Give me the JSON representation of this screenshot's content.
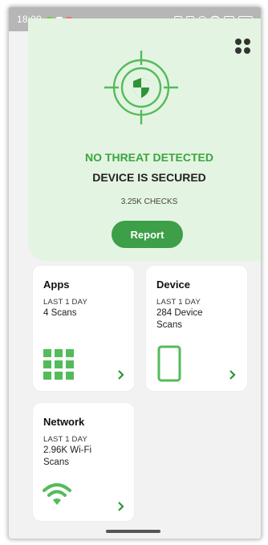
{
  "status_bar": {
    "time": "18:00"
  },
  "header": {
    "menu_icon": "grid-dots-icon"
  },
  "hero": {
    "status_line": "NO THREAT DETECTED",
    "secure_line": "DEVICE IS SECURED",
    "checks": "3.25K CHECKS",
    "report_label": "Report",
    "icon": "shield-radar-icon"
  },
  "cards": {
    "apps": {
      "title": "Apps",
      "period": "LAST 1 DAY",
      "value": "4 Scans",
      "icon": "apps-grid-icon"
    },
    "device": {
      "title": "Device",
      "period": "LAST 1 DAY",
      "value": "284 Device Scans",
      "icon": "phone-icon"
    },
    "network": {
      "title": "Network",
      "period": "LAST 1 DAY",
      "value": "2.96K Wi-Fi Scans",
      "icon": "wifi-icon"
    }
  },
  "colors": {
    "accent": "#3d9f48",
    "hero_bg": "#e4f4e2",
    "icon_green": "#54bb5a"
  }
}
